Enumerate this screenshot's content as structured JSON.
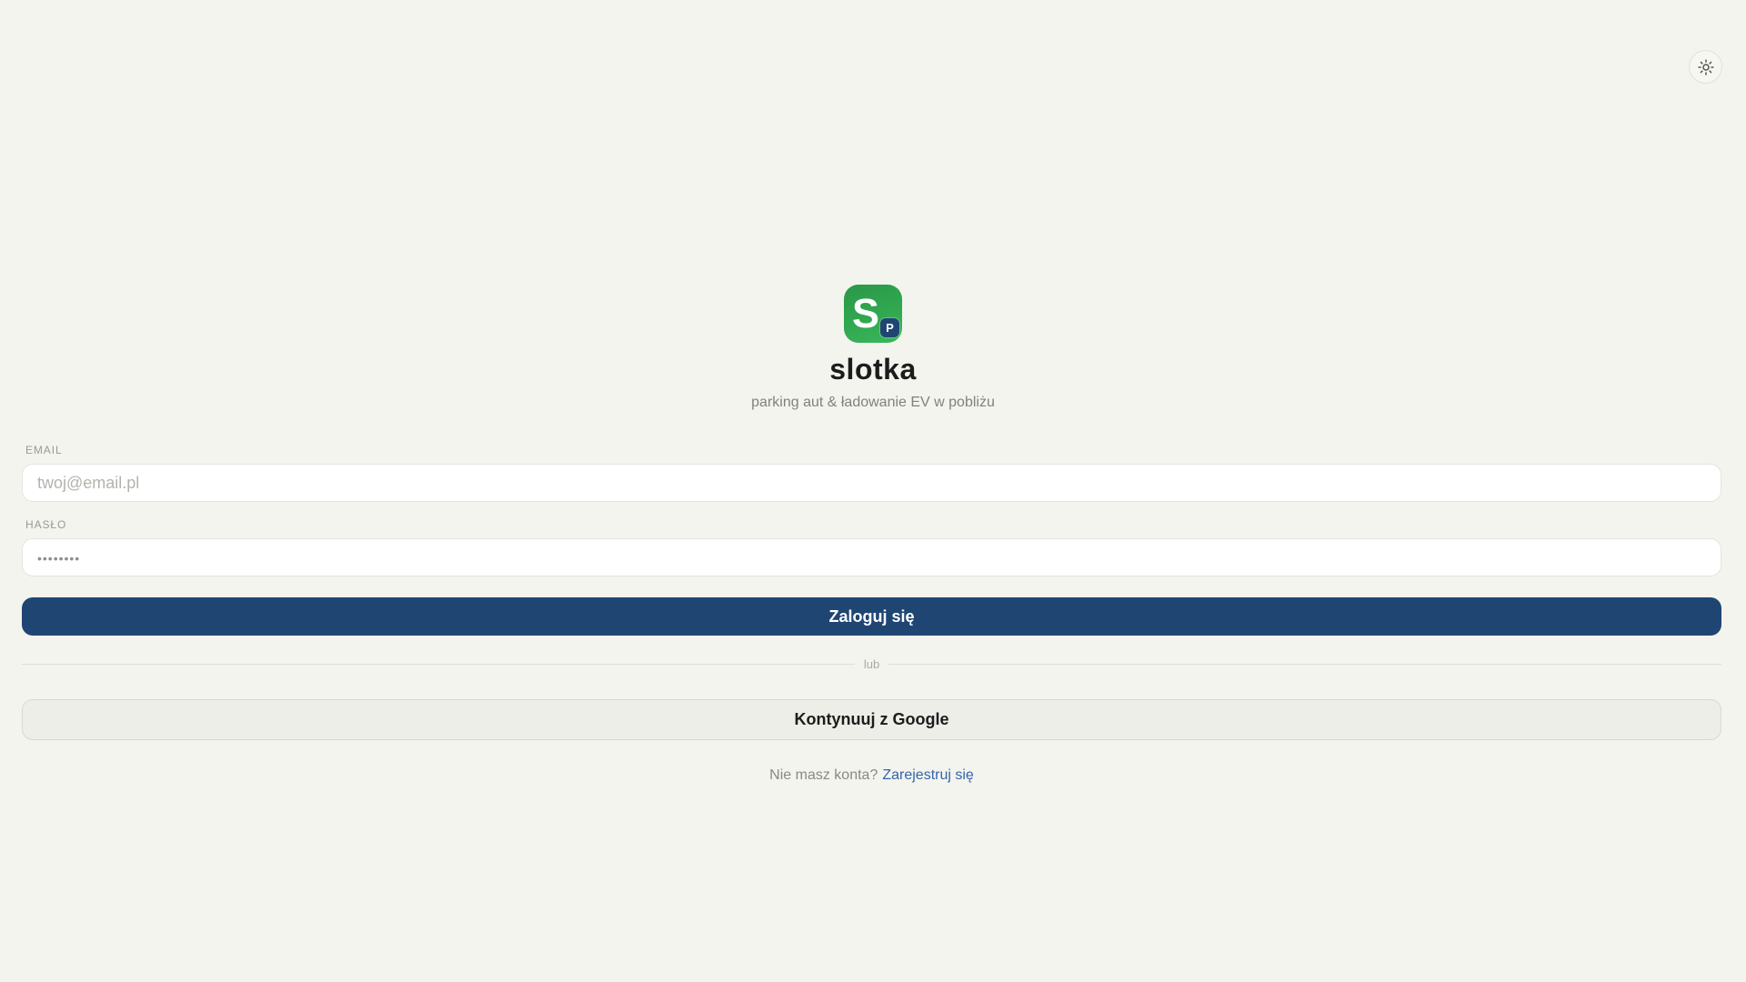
{
  "colors": {
    "background": "#f3f4ee",
    "accent_navy": "#1f4573",
    "logo_green_start": "#2a9749",
    "logo_green_end": "#3ab75b",
    "link_blue": "#3465ac"
  },
  "header": {
    "theme_toggle_icon": "sun-icon"
  },
  "brand": {
    "logo_letter": "S",
    "logo_badge_letter": "P",
    "title": "slotka",
    "tagline": "parking aut & ładowanie EV w pobliżu"
  },
  "form": {
    "email_label": "EMAIL",
    "email_placeholder": "twoj@email.pl",
    "email_value": "",
    "password_label": "HASŁO",
    "password_placeholder": "••••••••",
    "password_value": "",
    "submit_label": "Zaloguj się",
    "divider_label": "lub",
    "google_label": "Kontynuuj z Google",
    "register_prompt": "Nie masz konta?",
    "register_link_label": "Zarejestruj się"
  }
}
